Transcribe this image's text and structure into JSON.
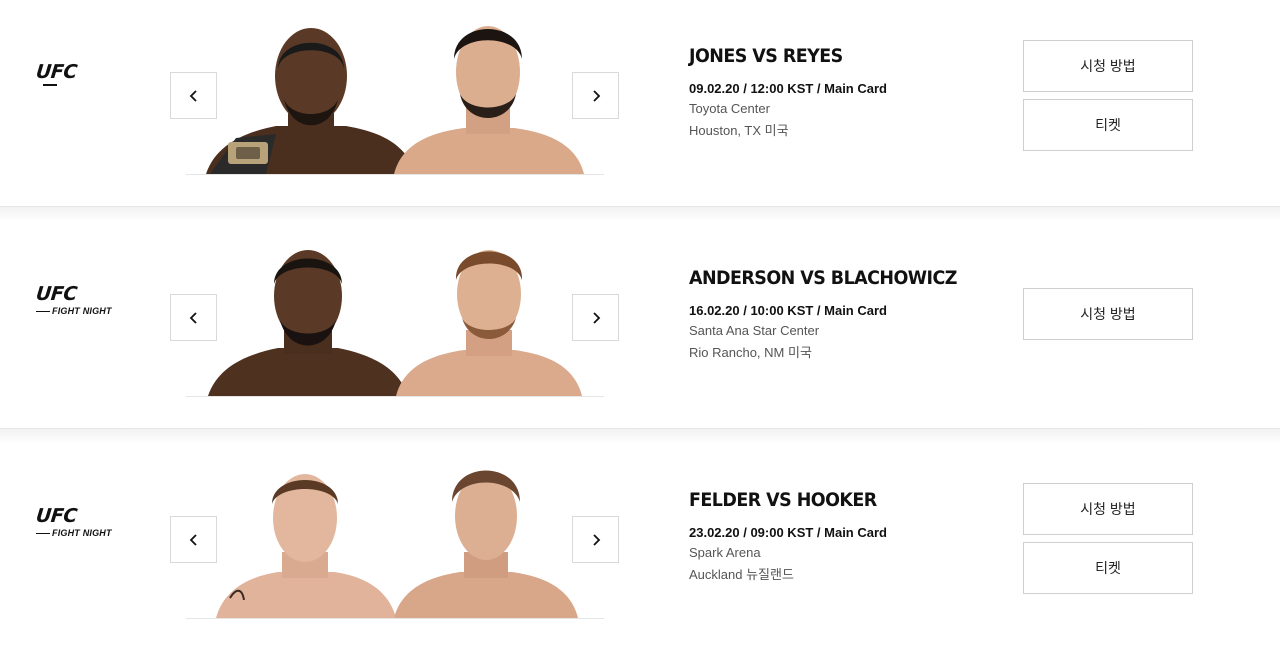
{
  "events": [
    {
      "logo_text": "UFC",
      "logo_sub": "",
      "title": "JONES VS REYES",
      "time": "09.02.20 / 12:00 KST / Main Card",
      "venue": "Toyota Center",
      "city": "Houston, TX 미국",
      "buttons": [
        "시청 방법",
        "티켓"
      ],
      "prev_icon": "chevron-left-icon",
      "next_icon": "chevron-right-icon"
    },
    {
      "logo_text": "UFC",
      "logo_sub": "FIGHT NIGHT",
      "title": "ANDERSON VS BLACHOWICZ",
      "time": "16.02.20 / 10:00 KST / Main Card",
      "venue": "Santa Ana Star Center",
      "city": "Rio Rancho, NM 미국",
      "buttons": [
        "시청 방법"
      ],
      "prev_icon": "chevron-left-icon",
      "next_icon": "chevron-right-icon"
    },
    {
      "logo_text": "UFC",
      "logo_sub": "FIGHT NIGHT",
      "title": "FELDER VS HOOKER",
      "time": "23.02.20 / 09:00 KST / Main Card",
      "venue": "Spark Arena",
      "city": "Auckland 뉴질랜드",
      "buttons": [
        "시청 방법",
        "티켓"
      ],
      "prev_icon": "chevron-left-icon",
      "next_icon": "chevron-right-icon"
    }
  ],
  "colors": {
    "text": "#111111",
    "muted": "#555555",
    "border": "#d9d9d9",
    "skin_dark": "#5a3a26",
    "skin_light": "#d9a98a"
  }
}
